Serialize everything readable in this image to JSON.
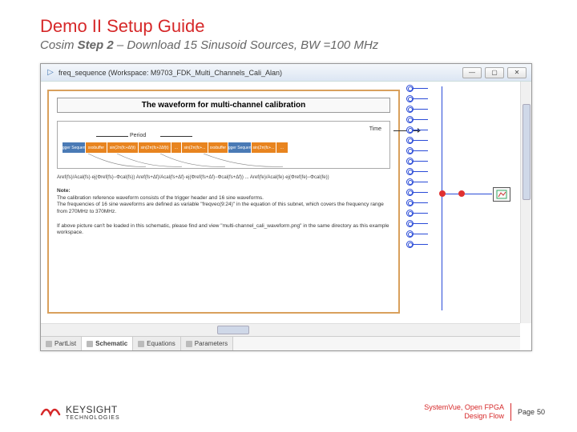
{
  "slide": {
    "title": "Demo II Setup Guide",
    "subtitle_prefix": "Cosim ",
    "subtitle_bold": "Step 2",
    "subtitle_suffix": " – Download 15 Sinusoid Sources, BW =100 MHz"
  },
  "window": {
    "icon": "▷",
    "title": "freq_sequence (Workspace: M9703_FDK_Multi_Channels_Cali_Alan)"
  },
  "doc": {
    "title": "The waveform for multi-channel calibration",
    "time_label": "Time",
    "period_label": "Period",
    "blocks": [
      {
        "label": "Trigger Sequence",
        "cls": "blue",
        "w": 28
      },
      {
        "label": "xxxbuffer",
        "cls": "",
        "w": 26
      },
      {
        "label": "sin(2π(fc+Δf)t)",
        "cls": "",
        "w": 38
      },
      {
        "label": "sin(2π(fc+2Δf)t)",
        "cls": "",
        "w": 40
      },
      {
        "label": "...",
        "cls": "",
        "w": 12
      },
      {
        "label": "sin(2π(fc+...",
        "cls": "",
        "w": 32
      },
      {
        "label": "xxxbuffer",
        "cls": "",
        "w": 24
      },
      {
        "label": "Trigger Sequence",
        "cls": "blue",
        "w": 28
      },
      {
        "label": "sin(2π(fc+...",
        "cls": "",
        "w": 30
      },
      {
        "label": "...",
        "cls": "",
        "w": 14
      }
    ],
    "formula": "Aref(fs)/Acal(fs)·ej(Φref(fs)−Φcal(fs))   Aref(fs+Δf)/Acal(fs+Δf)·ej(Φref(fs+Δf)−Φcal(fs+Δf))   ...   Aref(fe)/Acal(fe)·ej(Φref(fe)−Φcal(fe))",
    "note_heading": "Note:",
    "note_line1": "The calibration reference waveform consists of the trigger header and 16 sine waveforms.",
    "note_line2": "The frequencies of 16 sine waveforms are defined as variable \"freqvec(9:24)\" in the equation of this subnet, which covers the frequency range from 270MHz to 370MHz.",
    "note_line3": "If above picture can't be loaded in this schematic, please find and view \"multi-channel_cali_waveform.png\" in the same directory as this example workspace."
  },
  "tabs": [
    {
      "label": "PartList",
      "active": false
    },
    {
      "label": "Schematic",
      "active": true
    },
    {
      "label": "Equations",
      "active": false
    },
    {
      "label": "Parameters",
      "active": false
    }
  ],
  "sources_count": 16,
  "footer": {
    "brand": "KEYSIGHT",
    "brand_sub": "TECHNOLOGIES",
    "product": "SystemVue, Open FPGA Design Flow",
    "page_label": "Page",
    "page_number": "50"
  }
}
